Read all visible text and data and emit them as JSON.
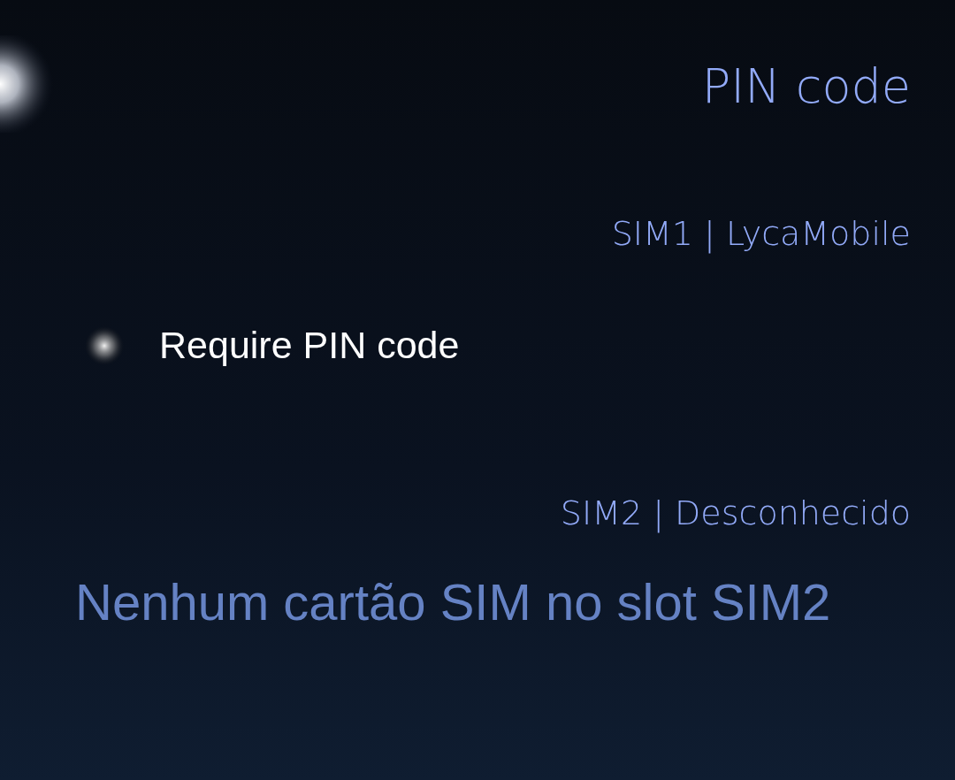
{
  "page": {
    "title": "PIN code"
  },
  "sections": [
    {
      "header": "SIM1 | LycaMobile",
      "items": [
        {
          "kind": "switch",
          "label": "Require PIN code",
          "checked": false
        }
      ]
    },
    {
      "header": "SIM2 | Desconhecido",
      "items": [
        {
          "kind": "message",
          "label": "Nenhum cartão SIM no slot SIM2"
        }
      ]
    }
  ]
}
